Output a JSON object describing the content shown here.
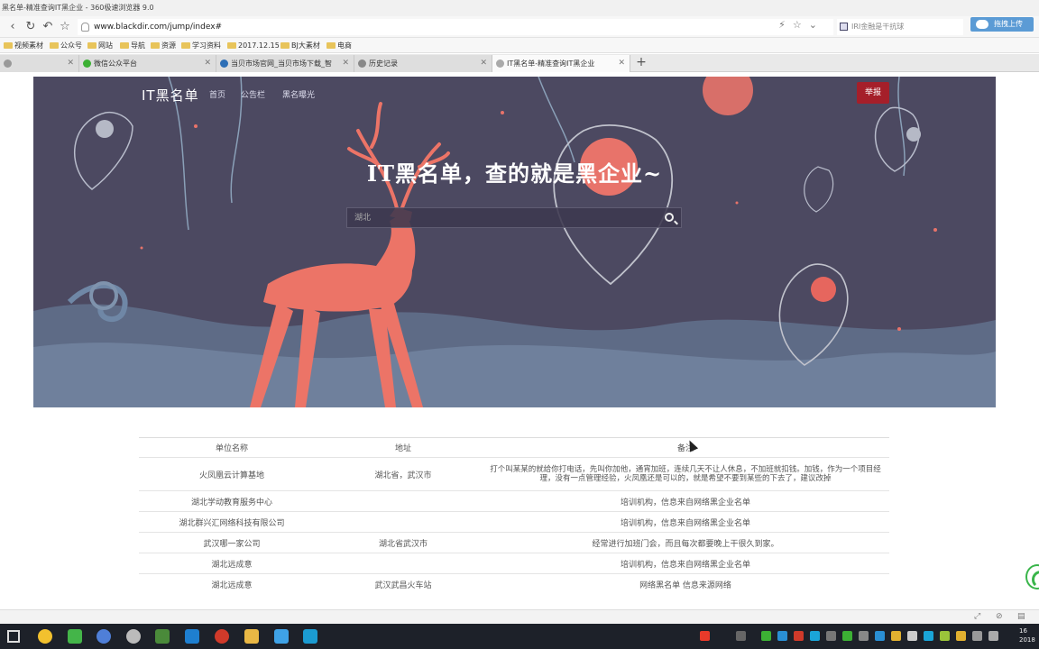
{
  "window": {
    "title": "黑名单-精准查询IT黑企业 - 360极速浏览器 9.0"
  },
  "toolbar": {
    "url": "www.blackdir.com/jump/index#",
    "search_text": "IRI金融是干抗球",
    "cloud_label": "拖拽上传"
  },
  "bookmarks": [
    "视频素材",
    "公众号",
    "网站",
    "导航",
    "资源",
    "学习资料",
    "2017.12.15",
    "BJ大素材",
    "电商"
  ],
  "tabs": [
    {
      "label": "",
      "icon_color": "#999"
    },
    {
      "label": "微信公众平台",
      "icon_color": "#3cb034"
    },
    {
      "label": "当贝市场官网_当贝市场下载_智",
      "icon_color": "#2e6fb6"
    },
    {
      "label": "历史记录",
      "icon_color": "#888"
    },
    {
      "label": "IT黑名单-精准查询IT黑企业",
      "icon_color": "#999",
      "active": true
    }
  ],
  "site": {
    "brand": "IT黑名单",
    "menu": [
      "首页",
      "公告栏",
      "黑名曝光"
    ],
    "report_button": "举报",
    "headline": "IT黑名单，查的就是黑企业~",
    "search_placeholder": "湖北"
  },
  "table": {
    "headers": [
      "单位名称",
      "地址",
      "备注"
    ],
    "rows": [
      [
        "火凤凰云计算基地",
        "湖北省，武汉市",
        "打个叫某某的就给你打电话，先叫你加他，通宵加班，连续几天不让人休息，不加班就扣钱。加钱，作为一个项目经理，没有一点管理经验，火凤凰还是可以的，就是希望不要到某些的下去了，建议改掉"
      ],
      [
        "湖北学动教育服务中心",
        "",
        "培训机构，信息来自网络黑企业名单"
      ],
      [
        "湖北群兴汇网络科技有限公司",
        "",
        "培训机构，信息来自网络黑企业名单"
      ],
      [
        "武汉哪一家公司",
        "湖北省武汉市",
        "经常进行加班门会，而且每次都要晚上干很久到家。"
      ],
      [
        "湖北远成意",
        "",
        "培训机构，信息来自网络黑企业名单"
      ],
      [
        "湖北远成意",
        "武汉武昌火车站",
        "网络黑名单 信息来源网络"
      ]
    ]
  },
  "clock": {
    "time": "16",
    "date": "2018"
  }
}
